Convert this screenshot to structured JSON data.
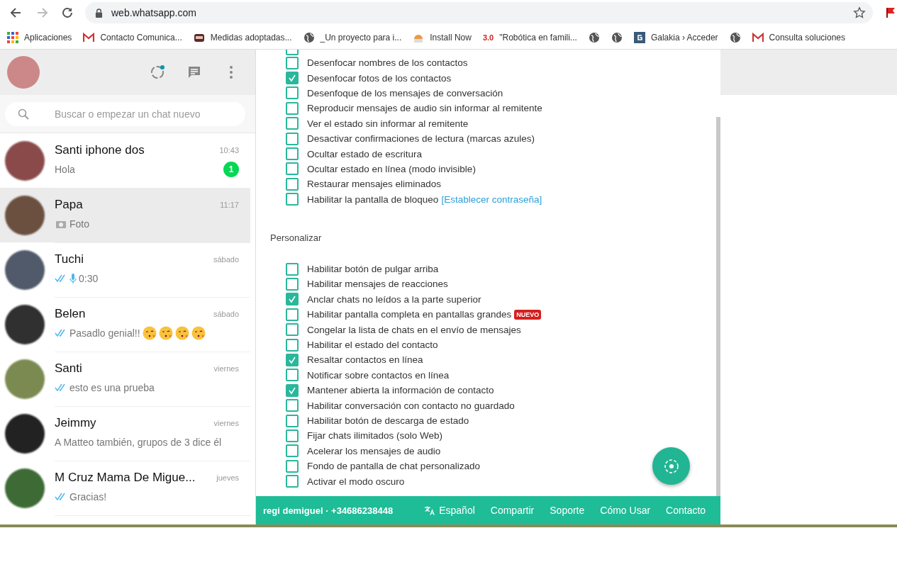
{
  "browser": {
    "url": "web.whatsapp.com",
    "bookmarks": [
      {
        "kind": "apps",
        "label": "Aplicaciones"
      },
      {
        "kind": "mail",
        "label": "Contacto Comunica..."
      },
      {
        "kind": "thumbnail",
        "label": "Medidas adoptadas..."
      },
      {
        "kind": "globe",
        "label": "_Un proyecto para i..."
      },
      {
        "kind": "installer",
        "label": "Install Now"
      },
      {
        "kind": "logo",
        "logo": "3.0",
        "label": "\"Robótica en famili..."
      },
      {
        "kind": "globe"
      },
      {
        "kind": "globe"
      },
      {
        "kind": "square",
        "label": "Galakia › Acceder"
      },
      {
        "kind": "globe"
      },
      {
        "kind": "mail",
        "label": "Consulta soluciones"
      }
    ]
  },
  "sidebar": {
    "search": {
      "placeholder": "Buscar o empezar un chat nuevo"
    },
    "chats": [
      {
        "name": "Santi iphone dos",
        "time": "10:43",
        "preview": "Hola",
        "unread": "1",
        "selected": false,
        "color": "#8a4a4a"
      },
      {
        "name": "Papa",
        "time": "11:17",
        "preview": "Foto",
        "kind": "photo",
        "read": false,
        "selected": true,
        "color": "#6b5040"
      },
      {
        "name": "Tuchi",
        "time": "sábado",
        "preview": "0:30",
        "kind": "voice",
        "read": true,
        "selected": false,
        "color": "#505a6a"
      },
      {
        "name": "Belen",
        "time": "sábado",
        "preview": "Pasadlo genial!!",
        "kind": "emoji",
        "read": true,
        "selected": false,
        "color": "#303030"
      },
      {
        "name": "Santi",
        "time": "viernes",
        "preview": "esto es una prueba",
        "kind": "text",
        "read": true,
        "selected": false,
        "color": "#7a8a50"
      },
      {
        "name": "Jeimmy",
        "time": "viernes",
        "preview": "A Matteo también, grupos de 3 dice él",
        "selected": false,
        "color": "#222222"
      },
      {
        "name": "M Cruz Mama De Migue...",
        "time": "jueves",
        "preview": "Gracias!",
        "kind": "text",
        "read": true,
        "selected": false,
        "color": "#3d6a35"
      }
    ]
  },
  "settings": {
    "privacy": [
      {
        "checked": false
      },
      {
        "label": "Desenfocar nombres de los contactos",
        "checked": false
      },
      {
        "label": "Desenfocar fotos de los contactos",
        "checked": true
      },
      {
        "label": "Desenfoque de los mensajes de conversación",
        "checked": false
      },
      {
        "label": "Reproducir mensajes de audio sin informar al remitente",
        "checked": false
      },
      {
        "label": "Ver el estado sin informar al remitente",
        "checked": false
      },
      {
        "label": "Desactivar confirmaciones de lectura (marcas azules)",
        "checked": false
      },
      {
        "label": "Ocultar estado de escritura",
        "checked": false
      },
      {
        "label": "Ocultar estado en línea (modo invisible)",
        "checked": false
      },
      {
        "label": "Restaurar mensajes eliminados",
        "checked": false
      },
      {
        "label": "Habilitar la pantalla de bloqueo",
        "link": "[Establecer contraseña]",
        "checked": false
      }
    ],
    "section_title": "Personalizar",
    "customize": [
      {
        "label": "Habilitar botón de pulgar arriba",
        "checked": false
      },
      {
        "label": "Habilitar mensajes de reacciones",
        "checked": false
      },
      {
        "label": "Anclar chats no leídos a la parte superior",
        "checked": true
      },
      {
        "label": "Habilitar pantalla completa en pantallas grandes",
        "badge": "NUEVO",
        "checked": false
      },
      {
        "label": "Congelar la lista de chats en el envío de mensajes",
        "checked": false
      },
      {
        "label": "Habilitar el estado del contacto",
        "checked": false
      },
      {
        "label": "Resaltar contactos en línea",
        "checked": true
      },
      {
        "label": "Notificar sobre contactos en línea",
        "checked": false
      },
      {
        "label": "Mantener abierta la información de contacto",
        "checked": true
      },
      {
        "label": "Habilitar conversación con contacto no guardado",
        "checked": false
      },
      {
        "label": "Habilitar botón de descarga de estado",
        "checked": false
      },
      {
        "label": "Fijar chats ilimitados (solo Web)",
        "checked": false
      },
      {
        "label": "Acelerar los mensajes de audio",
        "checked": false
      },
      {
        "label": "Fondo de pantalla de chat personalizado",
        "checked": false
      },
      {
        "label": "Activar el modo oscuro",
        "checked": false
      }
    ]
  },
  "footer": {
    "user": "regi demiguel · +34686238448",
    "language": "Español",
    "links": [
      "Compartir",
      "Soporte",
      "Cómo Usar",
      "Contacto"
    ]
  }
}
